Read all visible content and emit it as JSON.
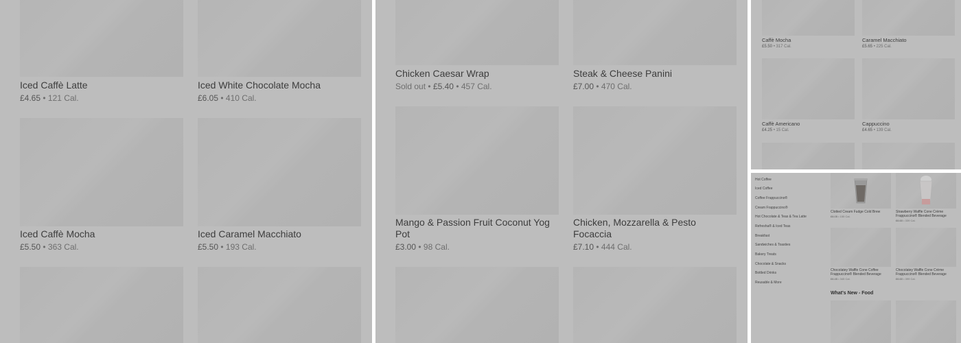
{
  "panel_drinks": {
    "items": [
      {
        "name": "Iced Caffè Latte",
        "price": "£4.65",
        "calories": "121 Cal."
      },
      {
        "name": "Iced White Chocolate Mocha",
        "price": "£6.05",
        "calories": "410 Cal."
      },
      {
        "name": "Iced Caffè Mocha",
        "price": "£5.50",
        "calories": "363 Cal."
      },
      {
        "name": "Iced Caramel Macchiato",
        "price": "£5.50",
        "calories": "193 Cal."
      }
    ]
  },
  "panel_food": {
    "items": [
      {
        "name": "Chicken Caesar Wrap",
        "status": "Sold out",
        "price": "£5.40",
        "calories": "457 Cal."
      },
      {
        "name": "Steak & Cheese Panini",
        "price": "£7.00",
        "calories": "470 Cal."
      },
      {
        "name": "Mango & Passion Fruit Coconut Yog Pot",
        "price": "£3.00",
        "calories": "98 Cal."
      },
      {
        "name": "Chicken, Mozzarella & Pesto Focaccia",
        "price": "£7.10",
        "calories": "444 Cal."
      }
    ]
  },
  "panel_hot": {
    "items": [
      {
        "name": "Caffè Mocha",
        "price": "£5.50",
        "calories": "317 Cal."
      },
      {
        "name": "Caramel Macchiato",
        "price": "£5.65",
        "calories": "225 Cal."
      },
      {
        "name": "Caffè Americano",
        "price": "£4.25",
        "calories": "15 Cal."
      },
      {
        "name": "Cappuccino",
        "price": "£4.65",
        "calories": "139 Cal."
      }
    ]
  },
  "panel_menu": {
    "sidebar": [
      "Hot Coffee",
      "Iced Coffee",
      "Coffee Frappuccino®",
      "Cream Frappuccino®",
      "Hot Chocolate & Teas & Tea Latte",
      "Refresha® & Iced Teas",
      "Breakfast",
      "Sandwiches & Toasties",
      "Bakery Treats",
      "Chocolate & Snacks",
      "Bottled Drinks",
      "Reusable & More"
    ],
    "items": [
      {
        "name": "Clotted Cream Fudge Cold Brew",
        "price": "£6.05",
        "calories": "155 Cal."
      },
      {
        "name": "Strawberry Waffle Cone Crème Frappuccino® Blended Beverage",
        "price": "£6.60",
        "calories": "339 Cal."
      },
      {
        "name": "Chocolatey Waffle Cone Coffee Frappuccino® Blended Beverage",
        "price": "£6.45",
        "calories": "345 Cal."
      },
      {
        "name": "Chocolatey Waffle Cone Crème Frappuccino® Blended Beverage",
        "price": "£6.60",
        "calories": "399 Cal."
      }
    ],
    "section_heading": "What's New - Food"
  },
  "separator": "•"
}
